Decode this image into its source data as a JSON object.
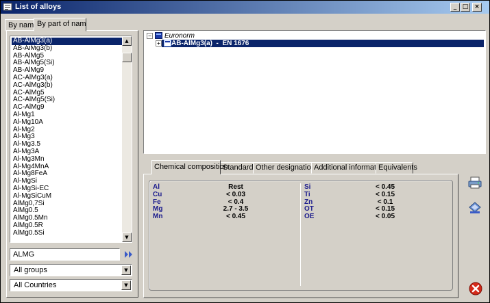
{
  "window": {
    "title": "List of alloys"
  },
  "left_tabs": [
    {
      "label": "By name"
    },
    {
      "label": "By part of name"
    }
  ],
  "alloy_list": [
    "AB-AlMg3(a)",
    "AB-AlMg3(b)",
    "AB-AlMg5",
    "AB-AlMg5(Si)",
    "AB-AlMg9",
    "AC-AlMg3(a)",
    "AC-AlMg3(b)",
    "AC-AlMg5",
    "AC-AlMg5(Si)",
    "AC-AlMg9",
    "Al-Mg1",
    "Al-Mg10A",
    "Al-Mg2",
    "Al-Mg3",
    "Al-Mg3.5",
    "Al-Mg3A",
    "Al-Mg3Mn",
    "Al-Mg4MnA",
    "Al-Mg8FeA",
    "Al-MgSi",
    "Al-MgSi-EC",
    "Al-MgSiCuM",
    "AlMg0,7Si",
    "AlMg0.5",
    "AlMg0.5Mn",
    "AlMg0.5R",
    "AlMg0.5Si"
  ],
  "selected_index": 0,
  "search": {
    "value": "ALMG"
  },
  "group_filter": {
    "value": "All groups"
  },
  "country_filter": {
    "value": "All Countries"
  },
  "tree": {
    "root": "Euronorm",
    "child": "AB-AlMg3(a)  -  EN 1676"
  },
  "detail_tabs": [
    {
      "label": "Chemical composition"
    },
    {
      "label": "Standards"
    },
    {
      "label": "Other designations"
    },
    {
      "label": "Additional information"
    },
    {
      "label": "Equivalents"
    }
  ],
  "composition": {
    "left": [
      {
        "element": "Al",
        "value": "Rest"
      },
      {
        "element": "Cu",
        "value": "< 0.03"
      },
      {
        "element": "Fe",
        "value": "< 0.4"
      },
      {
        "element": "Mg",
        "value": "2.7 - 3.5"
      },
      {
        "element": "Mn",
        "value": "< 0.45"
      }
    ],
    "right": [
      {
        "element": "Si",
        "value": "< 0.45"
      },
      {
        "element": "Ti",
        "value": "< 0.15"
      },
      {
        "element": "Zn",
        "value": "< 0.1"
      },
      {
        "element": "OT",
        "value": "< 0.15"
      },
      {
        "element": "OE",
        "value": "< 0.05"
      }
    ]
  },
  "icons": {
    "app": "alloy-list-icon",
    "print": "printer-icon",
    "export": "export-icon",
    "close": "close-red-icon"
  },
  "colors": {
    "titlebar": "#0a246a",
    "selection": "#0a246a",
    "element_label": "#1a1a8c",
    "close_red": "#d42a1a"
  }
}
